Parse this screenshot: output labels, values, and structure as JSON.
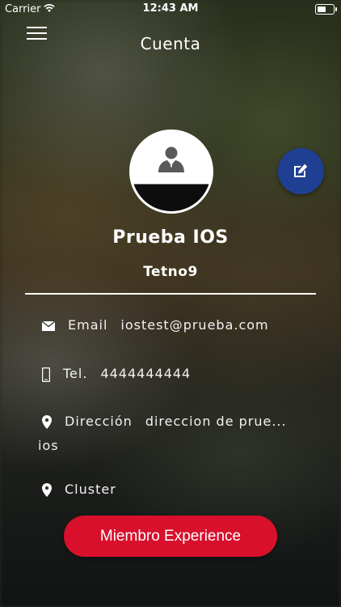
{
  "status_bar": {
    "carrier": "Carrier",
    "time": "12:43 AM"
  },
  "header": {
    "title": "Cuenta"
  },
  "profile": {
    "name": "Prueba IOS",
    "username": "Tetno9"
  },
  "details": {
    "email": {
      "label": "Email",
      "value": "iostest@prueba.com"
    },
    "phone": {
      "label": "Tel.",
      "value": "4444444444"
    },
    "address": {
      "label": "Dirección",
      "value": "direccion de prue...",
      "continuation": "ios"
    },
    "cluster": {
      "label": "Cluster"
    }
  },
  "cta": {
    "label": "Miembro Experience"
  },
  "colors": {
    "fab": "#1f3f93",
    "cta": "#d8102c"
  }
}
